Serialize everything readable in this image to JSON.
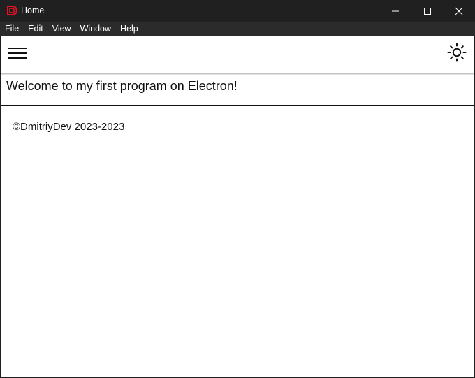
{
  "window": {
    "title": "Home",
    "icon": "app-logo-d-icon",
    "accent": "#e81123"
  },
  "menubar": {
    "items": [
      "File",
      "Edit",
      "View",
      "Window",
      "Help"
    ]
  },
  "header": {
    "menu_icon": "hamburger-menu-icon",
    "theme_icon": "sun-icon"
  },
  "main": {
    "welcome": "Welcome to my first program on Electron!"
  },
  "footer": {
    "copyright": "©DmitriyDev 2023-2023"
  }
}
